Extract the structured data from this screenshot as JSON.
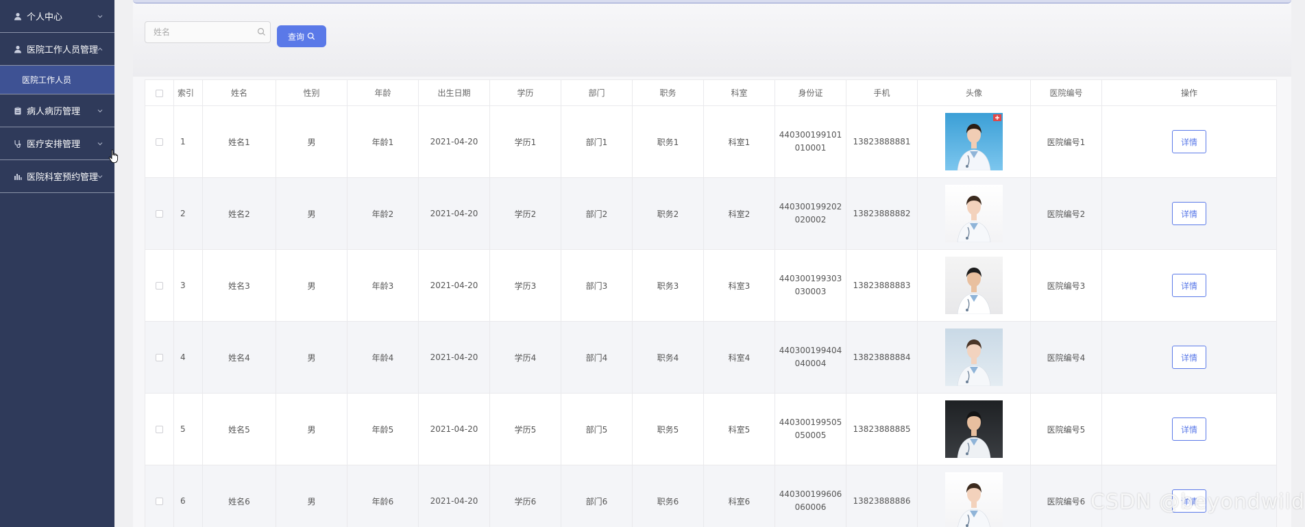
{
  "sidebar": {
    "bg": "#2f3a5a",
    "active_bg": "#3e5294",
    "items": [
      {
        "label": "个人中心",
        "icon": "user-icon"
      },
      {
        "label": "医院工作人员管理",
        "icon": "user-icon",
        "expanded": true
      },
      {
        "label": "病人病历管理",
        "icon": "clipboard-icon"
      },
      {
        "label": "医疗安排管理",
        "icon": "stethoscope-icon"
      },
      {
        "label": "医院科室预约管理",
        "icon": "bar-chart-icon"
      }
    ],
    "sub_item": {
      "label": "医院工作人员"
    }
  },
  "search": {
    "placeholder": "姓名",
    "value": "",
    "button_label": "查询"
  },
  "accent": "#5a79e8",
  "table": {
    "columns": [
      "",
      "索引",
      "姓名",
      "性别",
      "年龄",
      "出生日期",
      "学历",
      "部门",
      "职务",
      "科室",
      "身份证",
      "手机",
      "头像",
      "医院编号",
      "操作"
    ],
    "detail_label": "详情",
    "rows": [
      {
        "index": "1",
        "name": "姓名1",
        "gender": "男",
        "age": "年龄1",
        "birth": "2021-04-20",
        "edu": "学历1",
        "dept": "部门1",
        "position": "职务1",
        "office": "科室1",
        "id_line1": "440300199101",
        "id_line2": "010001",
        "phone": "13823888881",
        "avatar": "doctor-avatar-1",
        "hospital_no": "医院编号1"
      },
      {
        "index": "2",
        "name": "姓名2",
        "gender": "男",
        "age": "年龄2",
        "birth": "2021-04-20",
        "edu": "学历2",
        "dept": "部门2",
        "position": "职务2",
        "office": "科室2",
        "id_line1": "440300199202",
        "id_line2": "020002",
        "phone": "13823888882",
        "avatar": "doctor-avatar-2",
        "hospital_no": "医院编号2"
      },
      {
        "index": "3",
        "name": "姓名3",
        "gender": "男",
        "age": "年龄3",
        "birth": "2021-04-20",
        "edu": "学历3",
        "dept": "部门3",
        "position": "职务3",
        "office": "科室3",
        "id_line1": "440300199303",
        "id_line2": "030003",
        "phone": "13823888883",
        "avatar": "doctor-avatar-3",
        "hospital_no": "医院编号3"
      },
      {
        "index": "4",
        "name": "姓名4",
        "gender": "男",
        "age": "年龄4",
        "birth": "2021-04-20",
        "edu": "学历4",
        "dept": "部门4",
        "position": "职务4",
        "office": "科室4",
        "id_line1": "440300199404",
        "id_line2": "040004",
        "phone": "13823888884",
        "avatar": "doctor-avatar-4",
        "hospital_no": "医院编号4"
      },
      {
        "index": "5",
        "name": "姓名5",
        "gender": "男",
        "age": "年龄5",
        "birth": "2021-04-20",
        "edu": "学历5",
        "dept": "部门5",
        "position": "职务5",
        "office": "科室5",
        "id_line1": "440300199505",
        "id_line2": "050005",
        "phone": "13823888885",
        "avatar": "doctor-avatar-5",
        "hospital_no": "医院编号5"
      },
      {
        "index": "6",
        "name": "姓名6",
        "gender": "男",
        "age": "年龄6",
        "birth": "2021-04-20",
        "edu": "学历6",
        "dept": "部门6",
        "position": "职务6",
        "office": "科室6",
        "id_line1": "440300199606",
        "id_line2": "060006",
        "phone": "13823888886",
        "avatar": "doctor-avatar-2",
        "hospital_no": "医院编号6"
      }
    ]
  },
  "watermark": "CSDN @beyondwild"
}
